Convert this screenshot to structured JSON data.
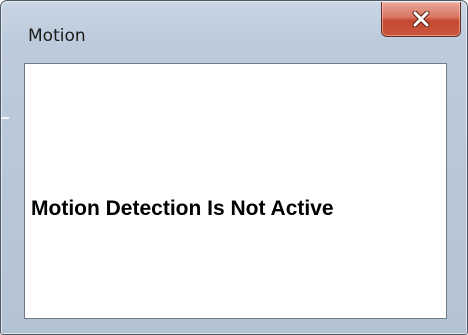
{
  "window": {
    "title": "Motion"
  },
  "content": {
    "status_message": "Motion Detection Is Not Active"
  },
  "icons": {
    "close": "close-icon"
  },
  "colors": {
    "frame": "#bccbdc",
    "close_button": "#c9553c",
    "client_background": "#ffffff",
    "text": "#000000"
  }
}
